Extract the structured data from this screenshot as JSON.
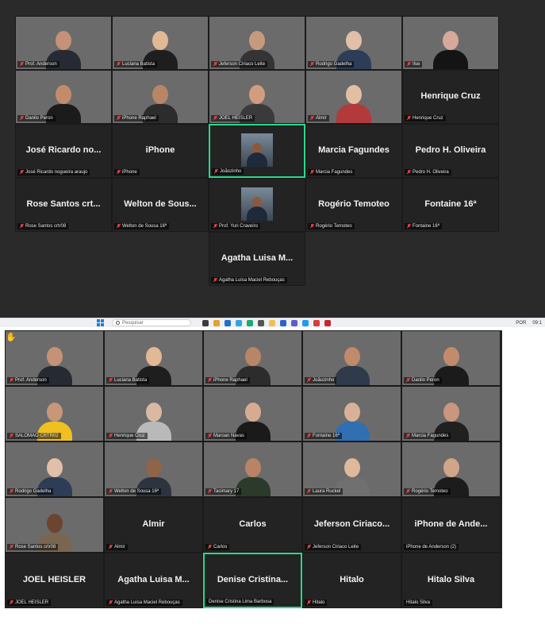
{
  "meeting1": {
    "tiles": [
      {
        "name": "Prof. Anderson",
        "video": true,
        "bg": "bg-room",
        "skin": "#c59277",
        "shirt": "#262a33"
      },
      {
        "name": "Luciana Batista",
        "video": true,
        "bg": "bg-light",
        "skin": "#e2b995",
        "shirt": "#1e1e1e"
      },
      {
        "name": "Jeferson Ciriaco Leite",
        "video": true,
        "bg": "bg-grey",
        "skin": "#c69b7d",
        "shirt": "#343434"
      },
      {
        "name": "Rodrigo Gadelha",
        "video": true,
        "bg": "bg-shelf",
        "skin": "#e1bfa8",
        "shirt": "#2d3d57"
      },
      {
        "name": "Ilse",
        "video": true,
        "bg": "bg-warm",
        "skin": "#d6a99a",
        "shirt": "#141414"
      },
      {
        "name": "Danilo Peron",
        "video": true,
        "bg": "bg-warm",
        "skin": "#c28c6c",
        "shirt": "#1b1b1b"
      },
      {
        "name": "iPhone Raphael",
        "video": true,
        "bg": "bg-grey",
        "skin": "#b88566",
        "shirt": "#2c2c2c"
      },
      {
        "name": "JOEL HEISLER",
        "video": true,
        "bg": "bg-light",
        "skin": "#d29d7f",
        "shirt": "#3a3a3a"
      },
      {
        "name": "Almir",
        "video": true,
        "bg": "bg-light",
        "skin": "#e2bfa3",
        "shirt": "#b23a3a"
      },
      {
        "name": "Henrique Cruz",
        "big": "Henrique Cruz",
        "video": false
      },
      {
        "name": "José Ricardo nogueira araujo",
        "big": "José Ricardo no...",
        "video": false
      },
      {
        "name": "iPhone",
        "big": "iPhone",
        "video": false
      },
      {
        "name": "Joãozinho",
        "video": false,
        "thumb": true,
        "active": true
      },
      {
        "name": "Marcia Fagundes",
        "big": "Marcia Fagundes",
        "video": false
      },
      {
        "name": "Pedro H. Oliveira",
        "big": "Pedro H. Oliveira",
        "video": false
      },
      {
        "name": "Rose Santos  crtr08",
        "big": "Rose Santos  crt...",
        "video": false
      },
      {
        "name": "Welton de Sousa 16ª",
        "big": "Welton de Sous...",
        "video": false
      },
      {
        "name": "Prof. Yuri Craveiro",
        "video": false,
        "thumb": true
      },
      {
        "name": "Rogério Temoteo",
        "big": "Rogério Temoteo",
        "video": false
      },
      {
        "name": "Fontaine 16ª",
        "big": "Fontaine 16ª",
        "video": false
      },
      {
        "name": "",
        "empty": true
      },
      {
        "name": "",
        "empty": true
      },
      {
        "name": "Agatha Luisa Maciel Rebouças",
        "big": "Agatha Luisa M...",
        "video": false
      },
      {
        "name": "",
        "empty": true
      },
      {
        "name": "",
        "empty": true
      }
    ]
  },
  "taskbar": {
    "search_placeholder": "Pesquisar",
    "lang": "POR",
    "time": "09:1"
  },
  "meeting2": {
    "hand_icon": "✋",
    "tiles": [
      {
        "name": "Prof. Anderson",
        "video": true,
        "bg": "bg-room",
        "skin": "#c59277",
        "shirt": "#262a33"
      },
      {
        "name": "Luciana Batista",
        "video": true,
        "bg": "bg-light",
        "skin": "#e2b995",
        "shirt": "#1e1e1e"
      },
      {
        "name": "iPhone Raphael",
        "video": true,
        "bg": "bg-grey",
        "skin": "#b88566",
        "shirt": "#2c2c2c"
      },
      {
        "name": "Joãozinho",
        "video": true,
        "bg": "bg-light",
        "skin": "#c18a6a",
        "shirt": "#2f3a4a"
      },
      {
        "name": "Danilo Peron",
        "video": true,
        "bg": "bg-warm",
        "skin": "#c28c6c",
        "shirt": "#1b1b1b"
      },
      {
        "name": "SALOMÃO CRTR02",
        "video": true,
        "bg": "bg-blue",
        "skin": "#c8977a",
        "shirt": "#f0c020"
      },
      {
        "name": "Henrique Cruz",
        "video": true,
        "bg": "bg-light",
        "skin": "#d9b9a2",
        "shirt": "#b9b9b9"
      },
      {
        "name": "Maroan Navas",
        "video": true,
        "bg": "bg-room",
        "skin": "#d7ab92",
        "shirt": "#1a1a1a"
      },
      {
        "name": "Fontaine 16ª",
        "video": true,
        "bg": "bg-light",
        "skin": "#d8b198",
        "shirt": "#2f6fb2"
      },
      {
        "name": "Marcia Fagundes",
        "video": true,
        "bg": "bg-grey",
        "skin": "#c8977e",
        "shirt": "#202020"
      },
      {
        "name": "Rodrigo Gadelha",
        "video": true,
        "bg": "bg-shelf",
        "skin": "#e1bfa8",
        "shirt": "#2d3d57"
      },
      {
        "name": "Welton de Sousa 16ª",
        "video": true,
        "bg": "bg-warm",
        "skin": "#8f6447",
        "shirt": "#2c3440"
      },
      {
        "name": "Tacimary 17",
        "video": true,
        "bg": "bg-light",
        "skin": "#b98466",
        "shirt": "#2b3a2b"
      },
      {
        "name": "Laura Ruckel",
        "video": true,
        "bg": "bg-light",
        "skin": "#e0b89c",
        "shirt": "#707070"
      },
      {
        "name": "Rogério Temoteo",
        "video": true,
        "bg": "bg-light",
        "skin": "#d1a58a",
        "shirt": "#1c1c1c"
      },
      {
        "name": "Rose Santos  crtr08",
        "video": true,
        "bg": "bg-warm",
        "skin": "#6b4530",
        "shirt": "#7a6650"
      },
      {
        "name": "Almir",
        "big": "Almir",
        "video": false
      },
      {
        "name": "Carlos",
        "big": "Carlos",
        "video": false
      },
      {
        "name": "Jeferson Ciriaco Leite",
        "big": "Jeferson Ciriaco...",
        "video": false
      },
      {
        "name": "iPhone de Anderson (2)",
        "big": "iPhone de Ande...",
        "video": false,
        "nomic": true
      },
      {
        "name": "JOEL HEISLER",
        "big": "JOEL HEISLER",
        "video": false
      },
      {
        "name": "Agatha Luisa Maciel Rebouças",
        "big": "Agatha Luisa M...",
        "video": false
      },
      {
        "name": "Denise Cristina Lima Barbosa",
        "big": "Denise Cristina...",
        "video": false,
        "active": true,
        "nomic": true
      },
      {
        "name": "Hitalo",
        "big": "Hitalo",
        "video": false
      },
      {
        "name": "Hitalo Silva",
        "big": "Hitalo Silva",
        "video": false,
        "nomic": true
      }
    ]
  }
}
